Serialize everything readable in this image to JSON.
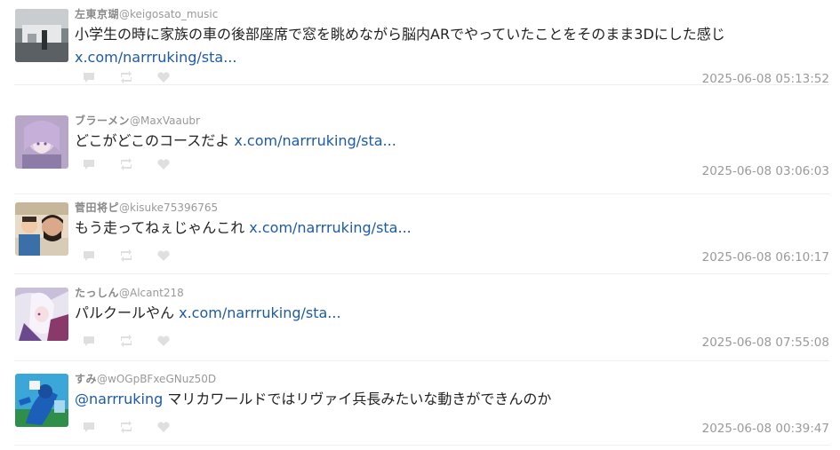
{
  "colors": {
    "link": "#1d5aa8",
    "text": "#222222",
    "meta": "#9a9a9a",
    "divider": "#eceef0"
  },
  "tweets": [
    {
      "name": "左東京瑚",
      "handle": "@keigosato_music",
      "text": "小学生の時に家族の車の後部座席で窓を眺めながら脳内ARでやっていたことをそのまま3Dにした感じ",
      "link": "x.com/narrruking/sta...",
      "time": "2025-06-08 05:13:52",
      "avatar": "rooftop-scene"
    },
    {
      "name": "ブラーメン",
      "handle": "@MaxVaaubr",
      "text": "どこがどこのコースだよ",
      "link": "x.com/narrruking/sta...",
      "time": "2025-06-08 03:06:03",
      "avatar": "anime-girl-purple"
    },
    {
      "name": "菅田将ピ",
      "handle": "@kisuke75396765",
      "text": "もう走ってねぇじゃんこれ",
      "link": "x.com/narrruking/sta...",
      "time": "2025-06-08 06:10:17",
      "avatar": "two-men-photo"
    },
    {
      "name": "たっしん",
      "handle": "@Alcant218",
      "text": "パルクールやん",
      "link": "x.com/narrruking/sta...",
      "time": "2025-06-08 07:55:08",
      "avatar": "anime-white-hair"
    },
    {
      "name": "すみ",
      "handle": "@wOGpBFxeGNuz50D",
      "mention": "@narrruking",
      "text": "マリカワールドではリヴァイ兵長みたいな動きができんのか",
      "time": "2025-06-08 00:39:47",
      "avatar": "blue-mascot"
    }
  ]
}
